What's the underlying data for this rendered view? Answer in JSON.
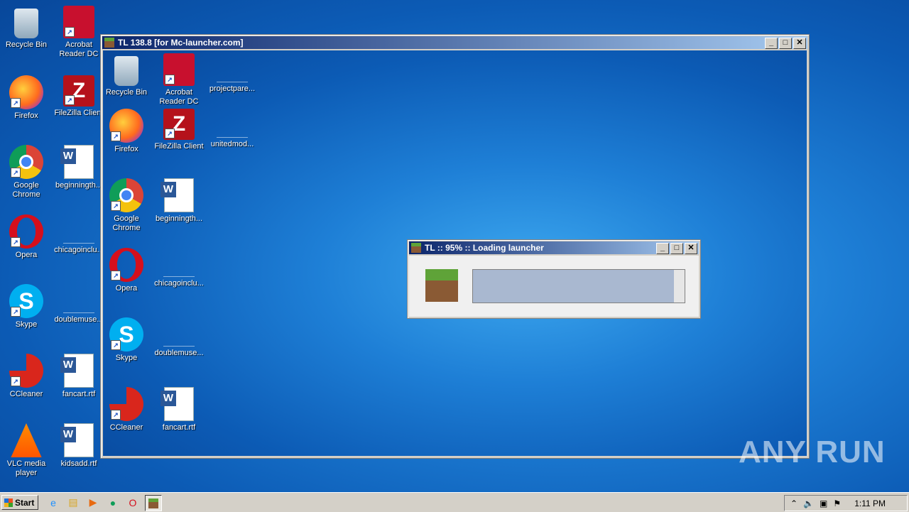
{
  "desktop": {
    "icons": [
      {
        "label": "Recycle Bin",
        "kind": "bin"
      },
      {
        "label": "Acrobat Reader DC",
        "kind": "acro"
      },
      {
        "label": "Firefox",
        "kind": "ff"
      },
      {
        "label": "FileZilla Client",
        "kind": "fz"
      },
      {
        "label": "Google Chrome",
        "kind": "chrome"
      },
      {
        "label": "beginningth...",
        "kind": "word"
      },
      {
        "label": "Opera",
        "kind": "opera"
      },
      {
        "label": "chicagoinclu...",
        "kind": "blank"
      },
      {
        "label": "Skype",
        "kind": "skype"
      },
      {
        "label": "doublemuse...",
        "kind": "blank"
      },
      {
        "label": "CCleaner",
        "kind": "cc"
      },
      {
        "label": "fancart.rtf",
        "kind": "word"
      },
      {
        "label": "VLC media player",
        "kind": "vlc"
      },
      {
        "label": "kidsadd.rtf",
        "kind": "word"
      }
    ]
  },
  "tl_window": {
    "title": "TL 138.8 [for Mc-launcher.com]",
    "icons": [
      {
        "label": "Recycle Bin"
      },
      {
        "label": "Acrobat Reader DC"
      },
      {
        "label": "projectpare..."
      },
      {
        "label": "Firefox"
      },
      {
        "label": "FileZilla Client"
      },
      {
        "label": "unitedmod..."
      },
      {
        "label": "Google Chrome"
      },
      {
        "label": "beginningth..."
      },
      {
        "label": "Opera"
      },
      {
        "label": "chicagoinclu..."
      },
      {
        "label": "Skype"
      },
      {
        "label": "doublemuse..."
      },
      {
        "label": "CCleaner"
      },
      {
        "label": "fancart.rtf"
      }
    ]
  },
  "loader": {
    "title": "TL :: 95% :: Loading launcher",
    "progress": 0.95
  },
  "window_buttons": {
    "minimize": "_",
    "maximize": "□",
    "close": "✕"
  },
  "taskbar": {
    "start_label": "Start",
    "clock": "1:11 PM"
  },
  "watermark": "ANY RUN"
}
